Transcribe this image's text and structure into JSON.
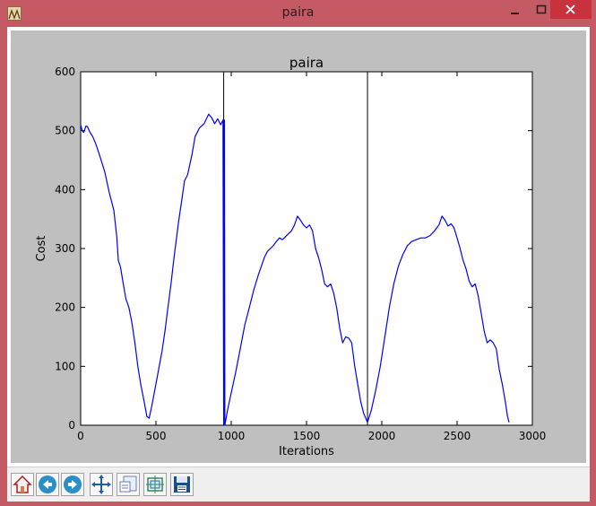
{
  "window": {
    "title": "paira",
    "controls": [
      "minimize-icon",
      "maximize-icon",
      "close-icon"
    ]
  },
  "colors": {
    "titlebar": "#c55a65",
    "plot_background": "#bfbfbf",
    "series": "#0000ff",
    "close_button": "#c7323c"
  },
  "toolbar": {
    "buttons": [
      {
        "name": "home-button",
        "icon": "home-icon"
      },
      {
        "name": "back-button",
        "icon": "back-arrow-icon"
      },
      {
        "name": "forward-button",
        "icon": "forward-arrow-icon"
      },
      {
        "name": "pan-button",
        "icon": "move-arrows-icon"
      },
      {
        "name": "zoom-button",
        "icon": "zoom-rect-icon"
      },
      {
        "name": "configure-subplots-button",
        "icon": "subplots-icon"
      },
      {
        "name": "save-button",
        "icon": "floppy-disk-icon"
      }
    ]
  },
  "chart_data": {
    "type": "line",
    "title": "paira",
    "xlabel": "Iterations",
    "ylabel": "Cost",
    "xlim": [
      0,
      3000
    ],
    "ylim": [
      0,
      600
    ],
    "xticks": [
      0,
      500,
      1000,
      1500,
      2000,
      2500,
      3000
    ],
    "yticks": [
      0,
      100,
      200,
      300,
      400,
      500,
      600
    ],
    "grid": false,
    "vlines": [
      950,
      1905
    ],
    "series": [
      {
        "color": "#0000ff",
        "points": [
          [
            0,
            510
          ],
          [
            10,
            500
          ],
          [
            20,
            497
          ],
          [
            35,
            508
          ],
          [
            45,
            507
          ],
          [
            60,
            498
          ],
          [
            80,
            490
          ],
          [
            100,
            478
          ],
          [
            130,
            455
          ],
          [
            160,
            430
          ],
          [
            190,
            395
          ],
          [
            220,
            365
          ],
          [
            240,
            320
          ],
          [
            250,
            280
          ],
          [
            265,
            268
          ],
          [
            280,
            245
          ],
          [
            300,
            215
          ],
          [
            320,
            200
          ],
          [
            340,
            175
          ],
          [
            360,
            140
          ],
          [
            380,
            100
          ],
          [
            400,
            68
          ],
          [
            420,
            42
          ],
          [
            440,
            15
          ],
          [
            455,
            12
          ],
          [
            470,
            30
          ],
          [
            500,
            70
          ],
          [
            540,
            125
          ],
          [
            560,
            160
          ],
          [
            580,
            200
          ],
          [
            600,
            240
          ],
          [
            620,
            285
          ],
          [
            650,
            345
          ],
          [
            670,
            380
          ],
          [
            690,
            415
          ],
          [
            710,
            425
          ],
          [
            740,
            460
          ],
          [
            760,
            490
          ],
          [
            790,
            505
          ],
          [
            820,
            512
          ],
          [
            850,
            528
          ],
          [
            870,
            522
          ],
          [
            890,
            512
          ],
          [
            910,
            520
          ],
          [
            930,
            510
          ],
          [
            945,
            518
          ],
          [
            950,
            0
          ],
          [
            955,
            518
          ],
          [
            958,
            0
          ],
          [
            975,
            25
          ],
          [
            1000,
            55
          ],
          [
            1030,
            90
          ],
          [
            1060,
            130
          ],
          [
            1090,
            170
          ],
          [
            1120,
            200
          ],
          [
            1150,
            230
          ],
          [
            1180,
            255
          ],
          [
            1200,
            270
          ],
          [
            1220,
            285
          ],
          [
            1240,
            295
          ],
          [
            1260,
            300
          ],
          [
            1280,
            305
          ],
          [
            1300,
            312
          ],
          [
            1320,
            318
          ],
          [
            1340,
            315
          ],
          [
            1360,
            320
          ],
          [
            1380,
            325
          ],
          [
            1400,
            330
          ],
          [
            1420,
            340
          ],
          [
            1440,
            355
          ],
          [
            1460,
            348
          ],
          [
            1480,
            340
          ],
          [
            1500,
            335
          ],
          [
            1520,
            340
          ],
          [
            1540,
            330
          ],
          [
            1560,
            300
          ],
          [
            1580,
            285
          ],
          [
            1600,
            265
          ],
          [
            1620,
            240
          ],
          [
            1640,
            235
          ],
          [
            1660,
            240
          ],
          [
            1680,
            225
          ],
          [
            1700,
            200
          ],
          [
            1720,
            165
          ],
          [
            1740,
            140
          ],
          [
            1760,
            150
          ],
          [
            1780,
            148
          ],
          [
            1800,
            140
          ],
          [
            1820,
            100
          ],
          [
            1840,
            70
          ],
          [
            1860,
            40
          ],
          [
            1880,
            20
          ],
          [
            1905,
            5
          ],
          [
            1930,
            25
          ],
          [
            1960,
            60
          ],
          [
            1990,
            100
          ],
          [
            2020,
            150
          ],
          [
            2050,
            200
          ],
          [
            2080,
            240
          ],
          [
            2110,
            270
          ],
          [
            2140,
            290
          ],
          [
            2170,
            305
          ],
          [
            2200,
            312
          ],
          [
            2230,
            315
          ],
          [
            2260,
            318
          ],
          [
            2290,
            318
          ],
          [
            2320,
            322
          ],
          [
            2350,
            330
          ],
          [
            2380,
            340
          ],
          [
            2400,
            355
          ],
          [
            2420,
            348
          ],
          [
            2440,
            338
          ],
          [
            2460,
            342
          ],
          [
            2480,
            335
          ],
          [
            2500,
            318
          ],
          [
            2520,
            300
          ],
          [
            2540,
            280
          ],
          [
            2560,
            265
          ],
          [
            2580,
            245
          ],
          [
            2600,
            235
          ],
          [
            2620,
            240
          ],
          [
            2640,
            220
          ],
          [
            2660,
            190
          ],
          [
            2680,
            160
          ],
          [
            2700,
            140
          ],
          [
            2720,
            145
          ],
          [
            2740,
            140
          ],
          [
            2760,
            130
          ],
          [
            2780,
            95
          ],
          [
            2800,
            70
          ],
          [
            2820,
            40
          ],
          [
            2835,
            15
          ],
          [
            2845,
            5
          ]
        ]
      }
    ]
  }
}
